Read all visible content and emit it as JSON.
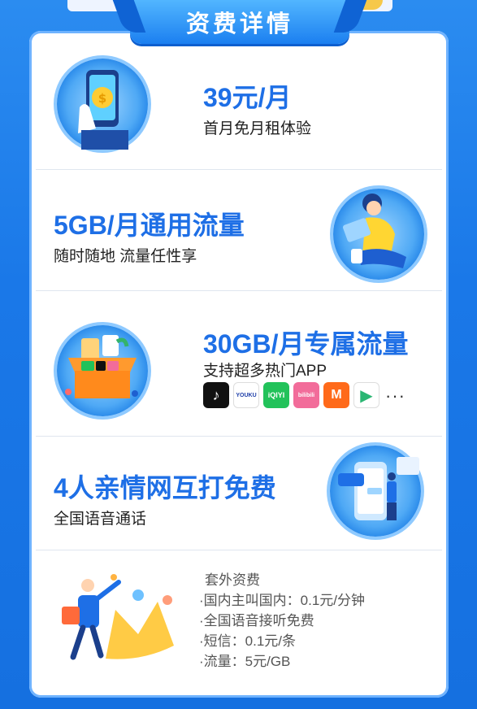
{
  "section_title": "资费详情",
  "items": [
    {
      "heading": "39元/月",
      "sub": "首月免月租体验",
      "icon": "phone-coin-icon"
    },
    {
      "heading": "5GB/月通用流量",
      "sub": "随时随地 流量任性享",
      "icon": "person-laptop-icon"
    },
    {
      "heading": "30GB/月专属流量",
      "sub": "支持超多热门APP",
      "icon": "gift-box-apps-icon"
    },
    {
      "heading": "4人亲情网互打免费",
      "sub": "全国语音通话",
      "icon": "phone-chat-person-icon"
    }
  ],
  "apps": [
    {
      "name": "douyin-icon",
      "label": "♪",
      "color": "#111111"
    },
    {
      "name": "youku-icon",
      "label": "YOUKU",
      "color": "#ffffff"
    },
    {
      "name": "iqiyi-icon",
      "label": "iQIYI",
      "color": "#22c25a"
    },
    {
      "name": "bilibili-icon",
      "label": "bilibili",
      "color": "#f26c9a"
    },
    {
      "name": "mgtv-icon",
      "label": "M",
      "color": "#ff6a1a"
    },
    {
      "name": "tencent-video-icon",
      "label": "▶",
      "color": "#ffffff"
    }
  ],
  "more": "···",
  "extra_fees": {
    "title": "套外资费",
    "lines": [
      "·国内主叫国内：0.1元/分钟",
      "·全国语音接听免费",
      "·短信：0.1元/条",
      "·流量：5元/GB"
    ]
  }
}
